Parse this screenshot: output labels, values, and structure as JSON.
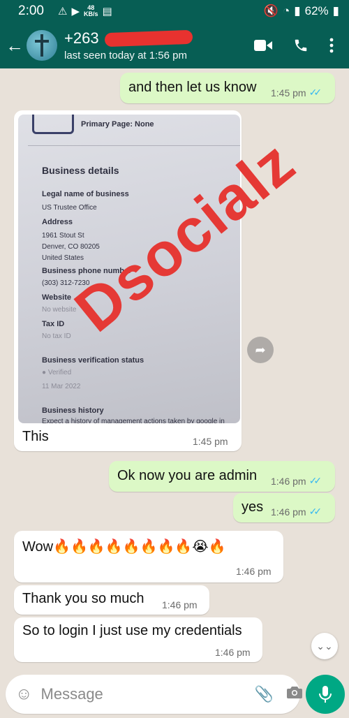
{
  "status_bar": {
    "time": "2:00",
    "kb_value": "48",
    "kb_unit": "KB/s",
    "battery": "62%"
  },
  "header": {
    "contact_name": "+263",
    "last_seen": "last seen today at 1:56 pm"
  },
  "messages": [
    {
      "direction": "out",
      "text": "and then let us know",
      "time": "1:45 pm",
      "read": true
    },
    {
      "direction": "in",
      "type": "image",
      "caption": "This",
      "time": "1:45 pm"
    },
    {
      "direction": "out",
      "text": "Ok now you are admin",
      "time": "1:46 pm",
      "read": true
    },
    {
      "direction": "out",
      "text": "yes",
      "time": "1:46 pm",
      "read": true
    },
    {
      "direction": "in",
      "text": "Wow🔥🔥🔥🔥🔥🔥🔥🔥😭🔥",
      "time": "1:46 pm"
    },
    {
      "direction": "in",
      "text": "Thank you so much",
      "time": "1:46 pm"
    },
    {
      "direction": "in",
      "text": "So to login I just use my credentials",
      "time": "1:46 pm"
    }
  ],
  "image_content": {
    "primary_page": "Primary Page: None",
    "section_title": "Business details",
    "legal_name_label": "Legal name of business",
    "legal_name": "US Trustee Office",
    "address_label": "Address",
    "address_line1": "1961 Stout St",
    "address_line2": "Denver, CO 80205",
    "address_line3": "United States",
    "phone_label": "Business phone number",
    "phone": "(303) 312-7230",
    "website_label": "Website",
    "website": "No website",
    "taxid_label": "Tax ID",
    "taxid": "No tax ID",
    "verification_label": "Business verification status",
    "verification": "Verified",
    "verification_date": "11 Mar 2022",
    "history_label": "Business history",
    "history_text": "Expect a history of management actions taken by google in",
    "watermark": "Dsocialz"
  },
  "input": {
    "placeholder": "Message"
  },
  "colors": {
    "header": "#075e54",
    "outgoing_bubble": "#dcf8c6",
    "incoming_bubble": "#ffffff",
    "read_ticks": "#34b7f1",
    "mic_button": "#00a884",
    "watermark": "#e53935"
  }
}
